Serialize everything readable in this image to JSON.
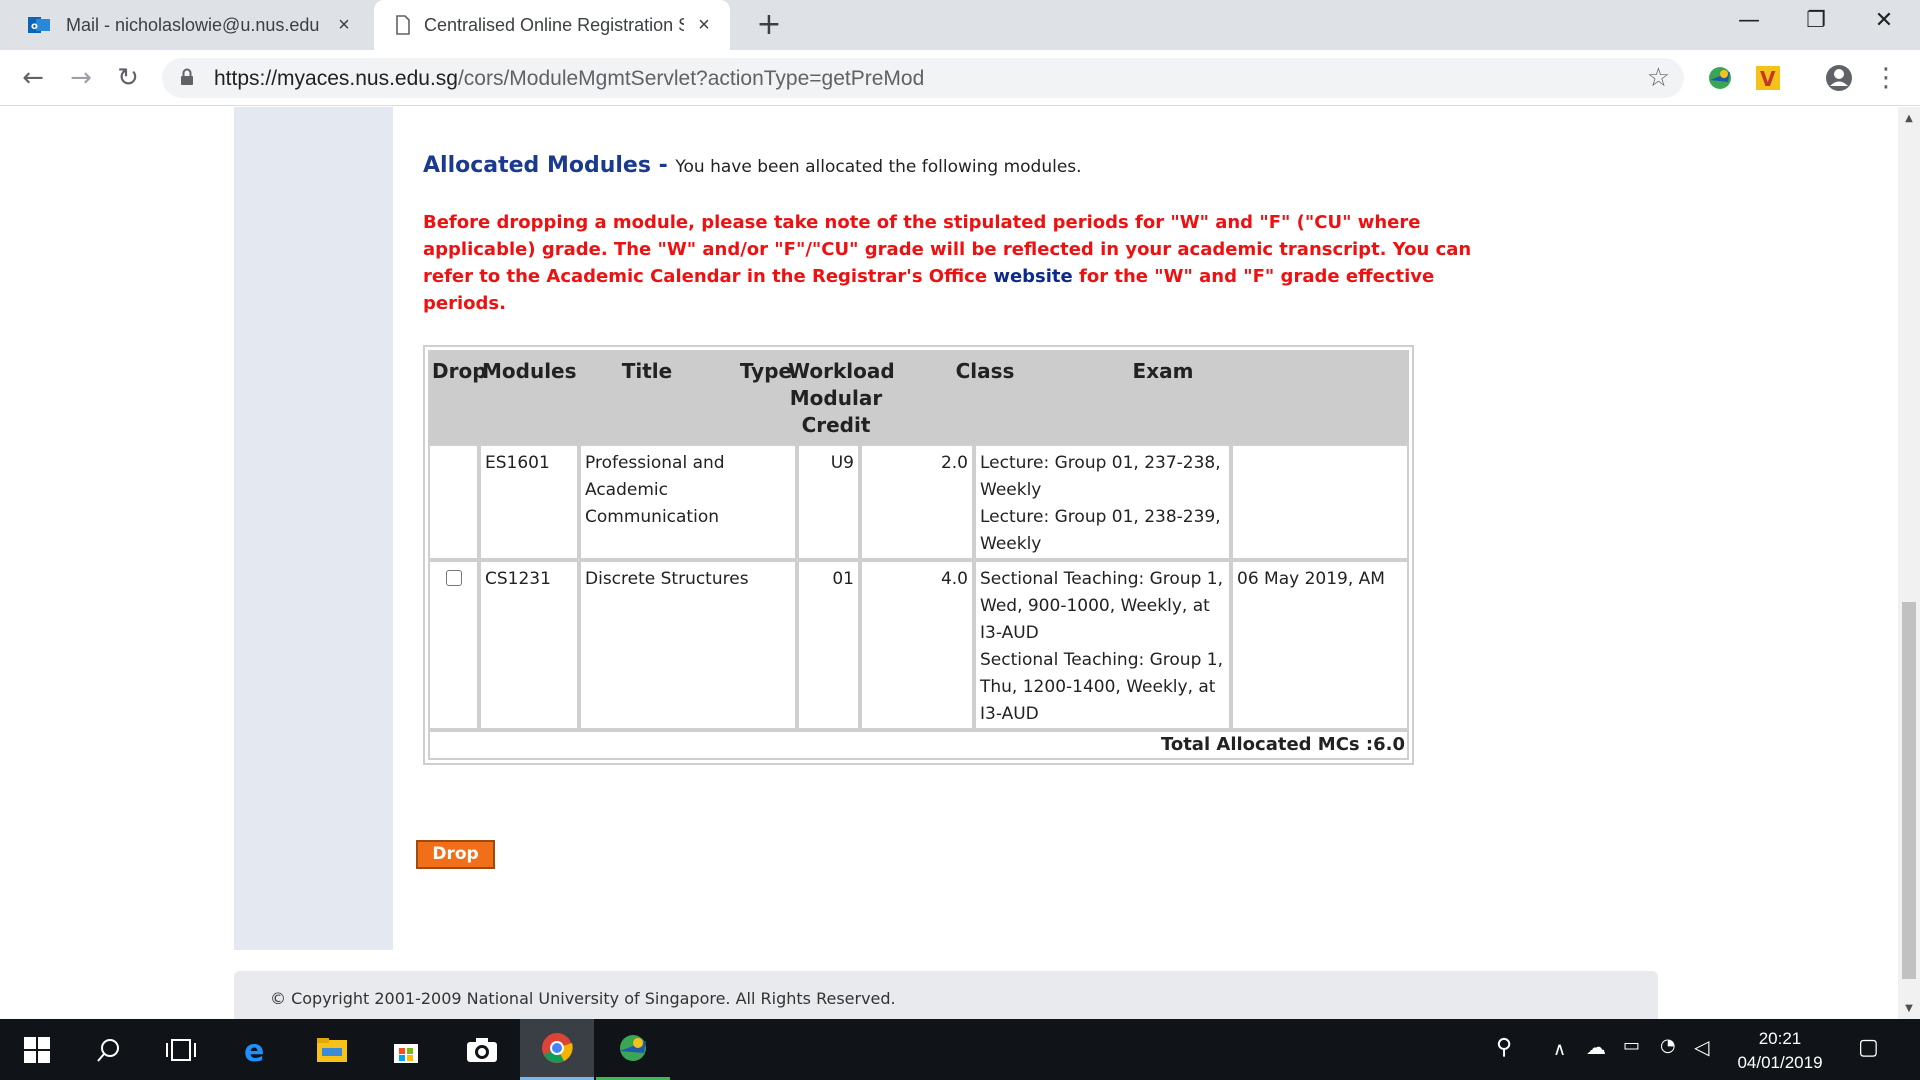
{
  "browser": {
    "tabs": [
      {
        "title": "Mail - nicholaslowie@u.nus.edu",
        "close": "×"
      },
      {
        "title": "Centralised Online Registration S",
        "close": "×"
      }
    ],
    "new_tab": "+",
    "window_controls": {
      "minimize": "—",
      "restore": "❐",
      "close": "✕"
    },
    "nav": {
      "back": "←",
      "forward": "→",
      "reload": "↻"
    },
    "url_host": "https://myaces.nus.edu.sg",
    "url_path": "/cors/ModuleMgmtServlet?actionType=getPreMod",
    "star": "☆",
    "menu": "⋮"
  },
  "page": {
    "heading_title": "Allocated Modules",
    "heading_dash": " - ",
    "heading_text": "You have been allocated the following modules.",
    "warning_part1": "Before dropping a module, please take note of the stipulated periods for \"W\" and \"F\" (\"CU\" where applicable) grade. The \"W\" and/or \"F\"/\"CU\" grade will be reflected in your academic transcript. You can refer to the Academic Calendar in the Registrar's Office ",
    "warning_link": "website",
    "warning_part2": " for the \"W\" and \"F\" grade effective periods.",
    "table": {
      "headers": [
        "Drop",
        "Modules",
        "Title",
        "Type",
        "Workload Modular Credit",
        "Class",
        "Exam"
      ],
      "rows": [
        {
          "drop": "",
          "module": "ES1601",
          "title": "Professional and Academic Communication",
          "type": "U9",
          "credit": "2.0",
          "class": "Lecture: Group 01, 237-238, Weekly\nLecture: Group 01, 238-239, Weekly",
          "exam": ""
        },
        {
          "drop": "checkbox",
          "module": "CS1231",
          "title": "Discrete Structures",
          "type": "01",
          "credit": "4.0",
          "class": "Sectional Teaching: Group 1, Wed, 900-1000, Weekly, at I3-AUD\nSectional Teaching: Group 1, Thu, 1200-1400, Weekly, at I3-AUD",
          "exam": "06 May 2019, AM"
        }
      ],
      "total": "Total Allocated MCs :6.0"
    },
    "drop_button": "Drop",
    "footer": "© Copyright 2001-2009 National University of Singapore. All Rights Reserved."
  },
  "taskbar": {
    "time": "20:21",
    "date": "04/01/2019"
  },
  "colors": {
    "accent_orange": "#f26f1a",
    "heading_blue": "#1a3a8f",
    "warning_red": "#ee1111",
    "side_column": "#e4e9f1"
  }
}
